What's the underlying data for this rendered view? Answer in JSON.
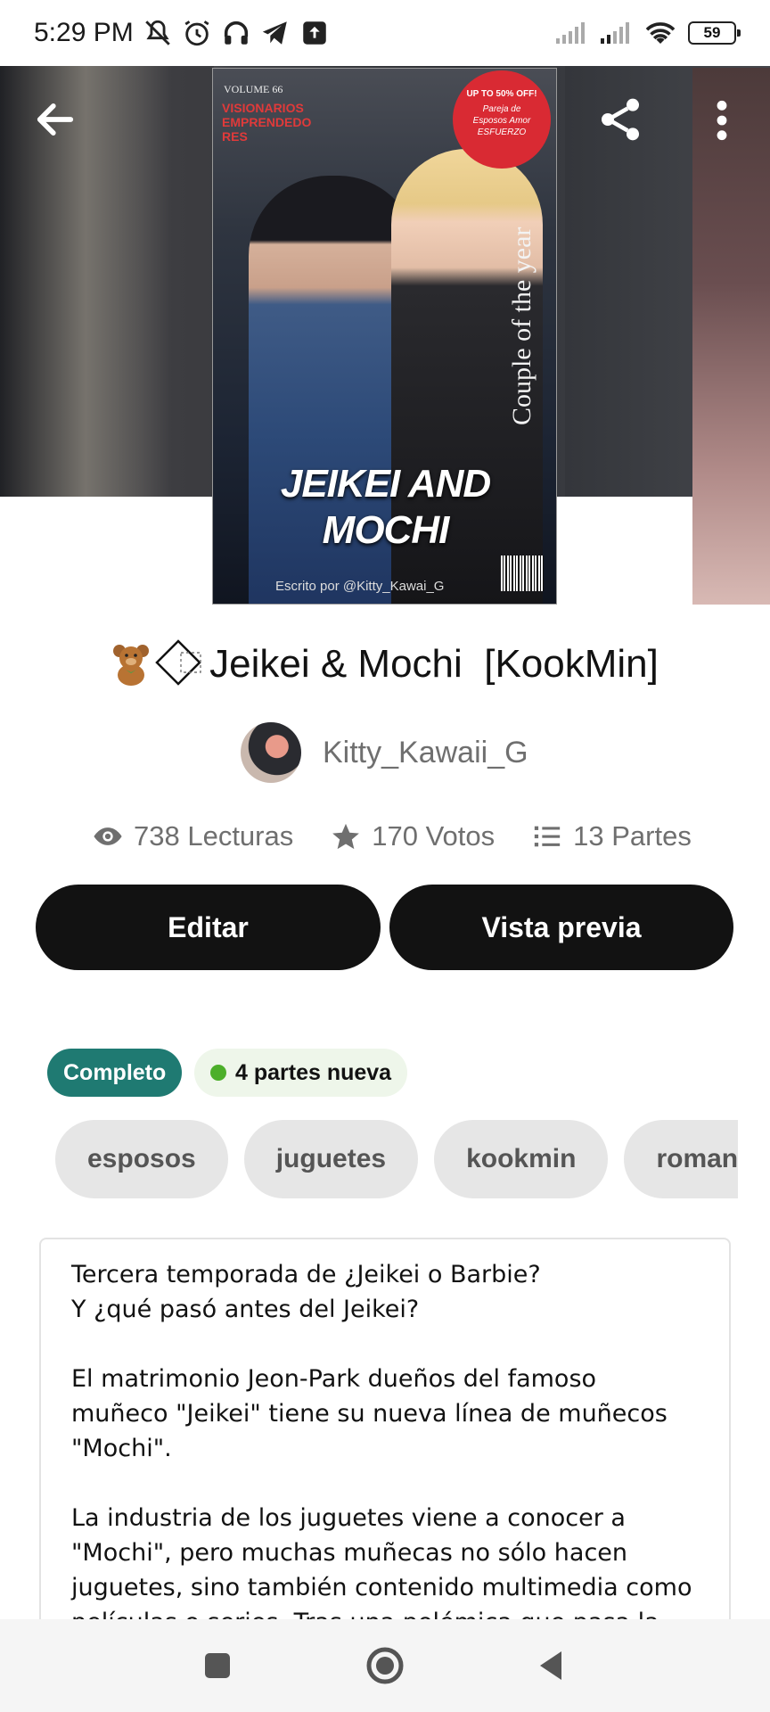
{
  "status_bar": {
    "time": "5:29 PM",
    "battery": "59",
    "icons": [
      "mute-bell-icon",
      "alarm-icon",
      "headset-icon",
      "telegram-icon",
      "upload-icon",
      "signal-icon",
      "signal-icon",
      "wifi-icon",
      "battery-icon"
    ]
  },
  "header": {
    "back_icon": "arrow-left-icon",
    "share_icon": "share-icon",
    "more_icon": "more-vertical-icon"
  },
  "cover": {
    "volume": "VOLUME 66",
    "kicker": "VISIONARIOS EMPRENDEDO RES",
    "sale": "UP TO 50% OFF!",
    "sale_sub": "Pareja de Esposos Amor ESFUERZO",
    "side_text": "Couple of the year",
    "title_line1": "JEIKEI AND",
    "title_line2": "MOCHI",
    "credit": "Escrito por @Kitty_Kawai_G"
  },
  "story": {
    "title_text": "Jeikei & Mochi  [KookMin]",
    "author": "Kitty_Kawaii_G"
  },
  "stats": {
    "reads": "738 Lecturas",
    "votes": "170 Votos",
    "parts": "13 Partes"
  },
  "buttons": {
    "edit": "Editar",
    "preview": "Vista previa"
  },
  "badges": {
    "status": "Completo",
    "new_parts": "4 partes nueva"
  },
  "tags": [
    "esposos",
    "juguetes",
    "kookmin",
    "romance"
  ],
  "description": {
    "p1": "Tercera temporada de ¿Jeikei o Barbie?\nY ¿qué pasó antes del Jeikei?",
    "p2": "El matrimonio Jeon-Park dueños del famoso muñeco \"Jeikei\" tiene su nueva línea de muñecos \"Mochi\".",
    "p3": "La industria de los juguetes viene a conocer a \"Mochi\", pero muchas muñecas no sólo hacen juguetes, sino también contenido multimedia como películas o series. Tras una polémica que pasa la compañía ¿Será posible que nuestro matrimonio"
  },
  "colors": {
    "accent_teal": "#1f7a72",
    "new_dot_green": "#4caf2a",
    "button_black": "#121212"
  }
}
